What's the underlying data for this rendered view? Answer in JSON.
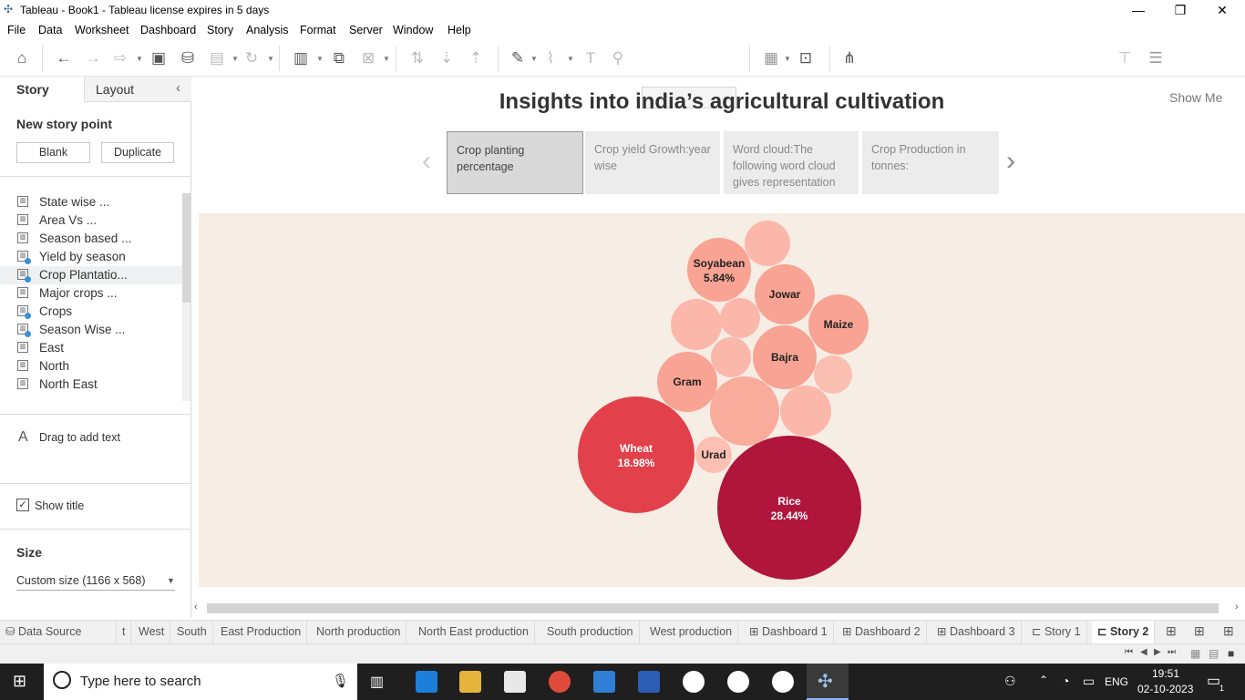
{
  "window": {
    "title": "Tableau - Book1 - Tableau license expires in 5 days",
    "controls": {
      "minimize": "—",
      "restore": "❐",
      "close": "✕"
    }
  },
  "menu": [
    "File",
    "Data",
    "Worksheet",
    "Dashboard",
    "Story",
    "Analysis",
    "Format",
    "Server",
    "Window",
    "Help"
  ],
  "toolbar": {
    "show_me": "Show Me"
  },
  "left_pane": {
    "tab_story": "Story",
    "tab_layout": "Layout",
    "new_story_point": "New story point",
    "blank_button": "Blank",
    "duplicate_button": "Duplicate",
    "sheets": [
      {
        "label": "State wise ...",
        "checked": false
      },
      {
        "label": "Area Vs ...",
        "checked": false
      },
      {
        "label": "Season based ...",
        "checked": false
      },
      {
        "label": "Yield by season",
        "checked": true
      },
      {
        "label": "Crop Plantatio...",
        "checked": true
      },
      {
        "label": "Major crops ...",
        "checked": false
      },
      {
        "label": "Crops",
        "checked": true
      },
      {
        "label": "Season Wise ...",
        "checked": true
      },
      {
        "label": "East",
        "checked": false
      },
      {
        "label": "North",
        "checked": false
      },
      {
        "label": "North East",
        "checked": false
      }
    ],
    "drag_text": "Drag to add text",
    "show_title": "Show title",
    "size_label": "Size",
    "size_value": "Custom size (1166 x 568)"
  },
  "story": {
    "title": "Insights into india’s agricultural cultivation",
    "points": [
      {
        "text": "Crop planting percentage",
        "active": true
      },
      {
        "text": "Crop yield Growth:year wise",
        "active": false
      },
      {
        "text": "Word cloud:The following word cloud gives representation",
        "active": false
      },
      {
        "text": "Crop Production in tonnes:",
        "active": false
      }
    ]
  },
  "chart_data": {
    "type": "bubble",
    "title": "",
    "bubbles": [
      {
        "label": "Rice",
        "value": "28.44%",
        "color": "#b0153b"
      },
      {
        "label": "Wheat",
        "value": "18.98%",
        "color": "#e2404a"
      },
      {
        "label": "Soyabean",
        "value": "5.84%",
        "color": "#f8a393"
      },
      {
        "label": "Jowar",
        "value": "",
        "color": "#f8a393"
      },
      {
        "label": "Maize",
        "value": "",
        "color": "#f8a393"
      },
      {
        "label": "Bajra",
        "value": "",
        "color": "#f8a393"
      },
      {
        "label": "Gram",
        "value": "",
        "color": "#f8a393"
      },
      {
        "label": "Urad",
        "value": "",
        "color": "#fbc0b2"
      },
      {
        "label": "",
        "value": "",
        "color": "#fbb8aa"
      },
      {
        "label": "",
        "value": "",
        "color": "#fbb8aa"
      },
      {
        "label": "",
        "value": "",
        "color": "#fbb8aa"
      },
      {
        "label": "",
        "value": "",
        "color": "#fbb8aa"
      },
      {
        "label": "",
        "value": "",
        "color": "#f9ab9c"
      },
      {
        "label": "",
        "value": "",
        "color": "#fbb8aa"
      },
      {
        "label": "",
        "value": "",
        "color": "#fbbfb1"
      }
    ]
  },
  "bottom_tabs": [
    "Data Source",
    "t",
    "West",
    "South",
    "East Production",
    "North production",
    "North East production",
    "South production",
    "West production",
    "Dashboard 1",
    "Dashboard 2",
    "Dashboard 3",
    "Story 1",
    "Story 2"
  ],
  "taskbar": {
    "search_placeholder": "Type here to search",
    "lang": "ENG",
    "time": "19:51",
    "date": "02-10-2023",
    "notif_count": "1"
  }
}
